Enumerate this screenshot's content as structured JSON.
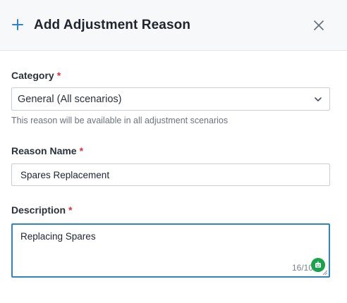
{
  "dialog": {
    "title": "Add Adjustment Reason",
    "icons": {
      "header": "plus-icon",
      "close": "close-icon"
    }
  },
  "form": {
    "required_marker": "*",
    "category": {
      "label": "Category",
      "value": "General (All scenarios)",
      "help": "This reason will be available in all adjustment scenarios"
    },
    "reason_name": {
      "label": "Reason Name",
      "value": "Spares Replacement"
    },
    "description": {
      "label": "Description",
      "value": "Replacing Spares",
      "counter": "16/10"
    }
  },
  "colors": {
    "accent": "#2f83c9",
    "required": "#e0323a",
    "assistant_badge": "#16a34a"
  }
}
